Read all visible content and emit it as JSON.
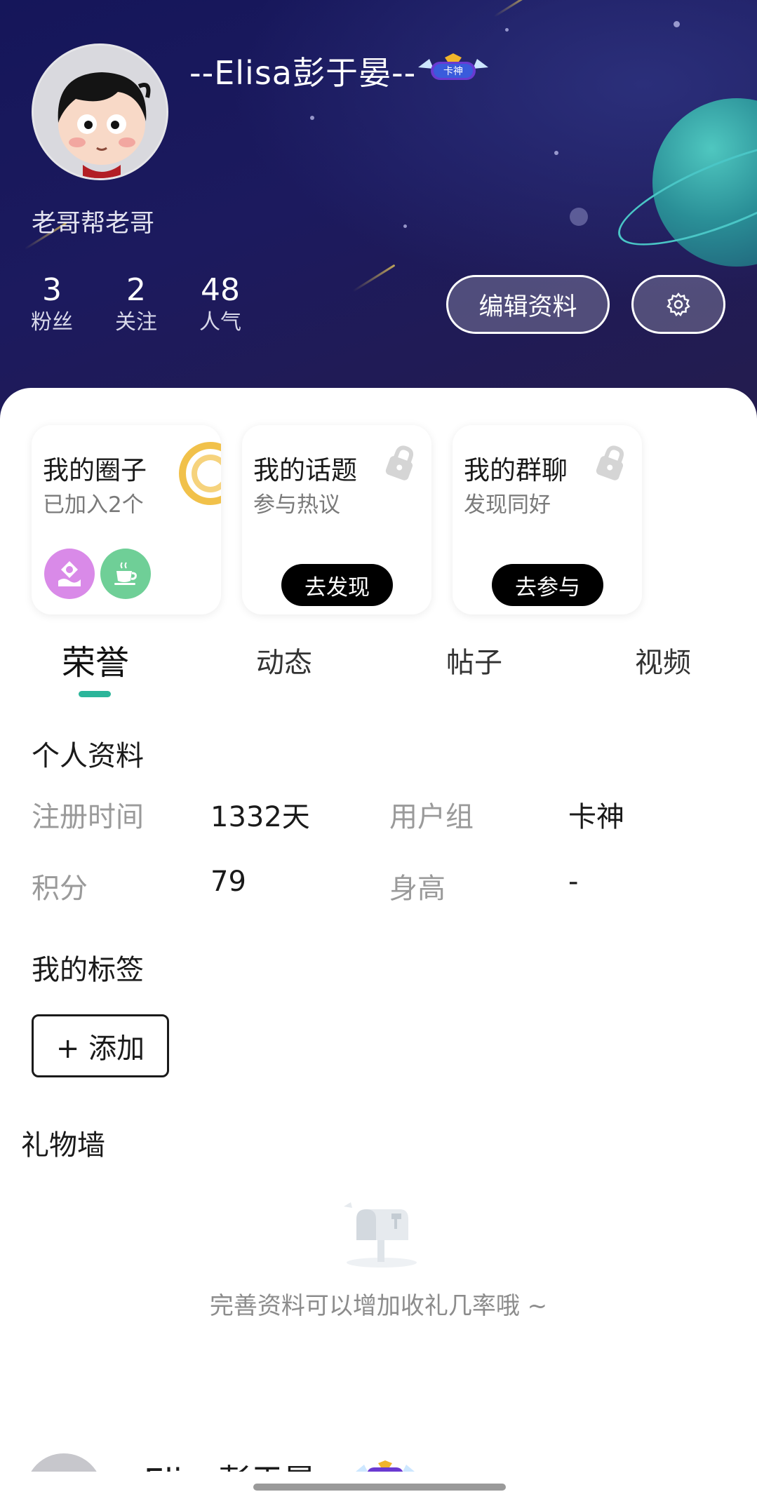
{
  "profile": {
    "username": "--Elisa彭于晏--",
    "badge_text": "卡神",
    "bio": "老哥帮老哥"
  },
  "stats": [
    {
      "value": "3",
      "label": "粉丝"
    },
    {
      "value": "2",
      "label": "关注"
    },
    {
      "value": "48",
      "label": "人气"
    }
  ],
  "actions": {
    "edit_profile": "编辑资料",
    "settings_icon": "gear-icon"
  },
  "cards": {
    "circles": {
      "title": "我的圈子",
      "subtitle": "已加入2个"
    },
    "topics": {
      "title": "我的话题",
      "subtitle": "参与热议",
      "button": "去发现"
    },
    "groups": {
      "title": "我的群聊",
      "subtitle": "发现同好",
      "button": "去参与"
    }
  },
  "tabs": [
    {
      "label": "荣誉",
      "active": true
    },
    {
      "label": "动态",
      "active": false
    },
    {
      "label": "帖子",
      "active": false
    },
    {
      "label": "视频",
      "active": false
    }
  ],
  "profile_info": {
    "title": "个人资料",
    "rows": [
      {
        "label1": "注册时间",
        "value1": "1332天",
        "label2": "用户组",
        "value2": "卡神"
      },
      {
        "label1": "积分",
        "value1": "79",
        "label2": "身高",
        "value2": "-"
      }
    ]
  },
  "tags": {
    "title": "我的标签",
    "add_button": "+ 添加"
  },
  "gift_wall": {
    "title": "礼物墙",
    "empty_text": "完善资料可以增加收礼几率哦 ~"
  },
  "peek": {
    "username": "Elisa彭于晏"
  },
  "colors": {
    "accent": "#2bb59a",
    "header_bg": "#1c1a5e"
  }
}
